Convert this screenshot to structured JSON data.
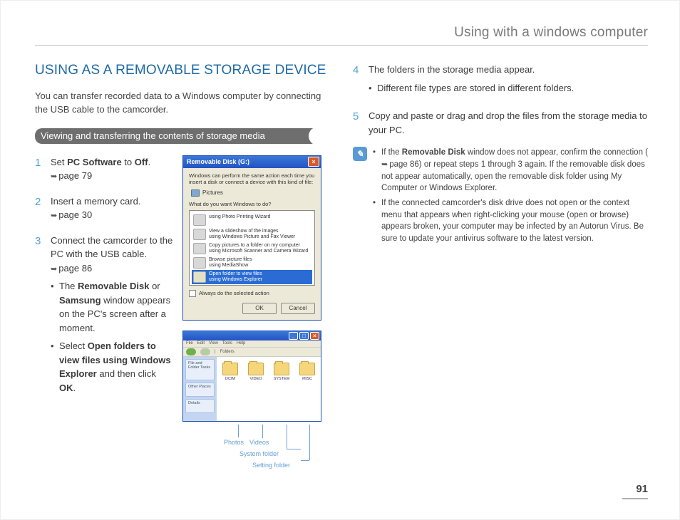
{
  "header": {
    "title": "Using with a windows computer"
  },
  "page_number": "91",
  "section": {
    "title": "USING AS A REMOVABLE STORAGE DEVICE",
    "intro": "You can transfer recorded data to a Windows computer by connecting the USB cable to the camcorder.",
    "subhead": "Viewing and transferring the contents of storage media"
  },
  "steps_left": {
    "s1_a": "Set ",
    "s1_b": "PC Software",
    "s1_c": " to ",
    "s1_d": "Off",
    "s1_e": ".",
    "s1_ref": "page 79",
    "s2": "Insert a memory card.",
    "s2_ref": "page 30",
    "s3": "Connect the camcorder to the PC with the USB cable.",
    "s3_ref": "page 86",
    "s3_b1_a": "The ",
    "s3_b1_b": "Removable Disk",
    "s3_b1_c": " or ",
    "s3_b1_d": "Samsung",
    "s3_b1_e": " window appears on the PC's screen after a moment.",
    "s3_b2_a": "Select ",
    "s3_b2_b": "Open folders to view files using Windows Explorer",
    "s3_b2_c": " and then click ",
    "s3_b2_d": "OK",
    "s3_b2_e": "."
  },
  "dialog": {
    "title": "Removable Disk (G:)",
    "desc": "Windows can perform the same action each time you insert a disk or connect a device with this kind of file:",
    "pictures": "Pictures",
    "prompt": "What do you want Windows to do?",
    "opt1a": "using Photo Printing Wizard",
    "opt2a": "View a slideshow of the images",
    "opt2b": "using Windows Picture and Fax Viewer",
    "opt3a": "Copy pictures to a folder on my computer",
    "opt3b": "using Microsoft Scanner and Camera Wizard",
    "opt4a": "Browse picture files",
    "opt4b": "using MediaShow",
    "opt5a": "Open folder to view files",
    "opt5b": "using Windows Explorer",
    "always": "Always do the selected action",
    "ok": "OK",
    "cancel": "Cancel"
  },
  "explorer": {
    "menu_file": "File",
    "menu_edit": "Edit",
    "menu_view": "View",
    "menu_tools": "Tools",
    "menu_help": "Help",
    "folders_label": "Folders",
    "side1": "File and Folder Tasks",
    "side2": "Other Places",
    "side3": "Details",
    "f1": "DCIM",
    "f2": "VIDEO",
    "f3": "SYSTEM",
    "f4": "MISC"
  },
  "callouts": {
    "photos": "Photos",
    "videos": "Videos",
    "system": "System folder",
    "setting": "Setting folder"
  },
  "steps_right": {
    "s4": "The folders in the storage media appear.",
    "s4_b1": "Different file types are stored in different folders.",
    "s5": "Copy and paste or drag and drop the files from the storage media to your PC."
  },
  "notes": {
    "n1_a": "If the ",
    "n1_b": "Removable Disk",
    "n1_c": " window does not appear, confirm the connection (",
    "n1_ref": "page 86",
    "n1_d": ") or repeat steps 1 through 3 again. If the removable disk does not appear automatically, open the removable disk folder using My Computer or Windows Explorer.",
    "n2": "If the connected camcorder's disk drive does not open or the context menu that appears when right-clicking your mouse (open or browse) appears broken, your computer may be infected by an Autorun Virus. Be sure to update your antivirus software to the latest version."
  }
}
